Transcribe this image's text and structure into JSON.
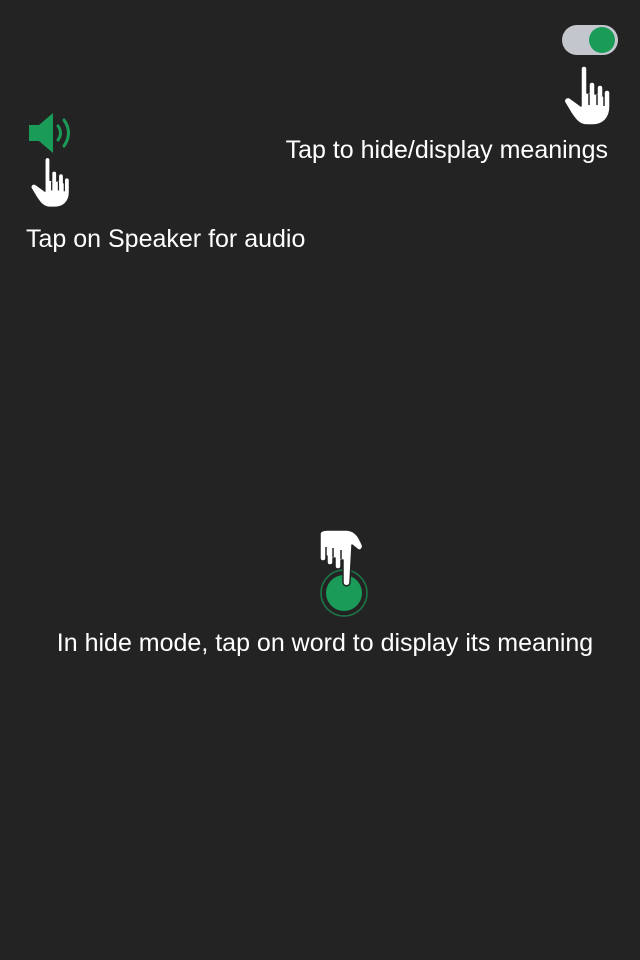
{
  "colors": {
    "background": "#232323",
    "accent": "#1a9b58",
    "toggle_track": "#c3c7cd",
    "text": "#ffffff"
  },
  "toggle": {
    "state": "on",
    "icon": "toggle-switch-icon"
  },
  "hints": {
    "toggle": "Tap to hide/display meanings",
    "speaker": "Tap on Speaker for audio",
    "word": "In hide mode, tap on word to display its meaning"
  },
  "icons": {
    "speaker": "speaker-icon",
    "hand": "pointing-hand-icon",
    "tap_target": "tap-target-icon"
  }
}
